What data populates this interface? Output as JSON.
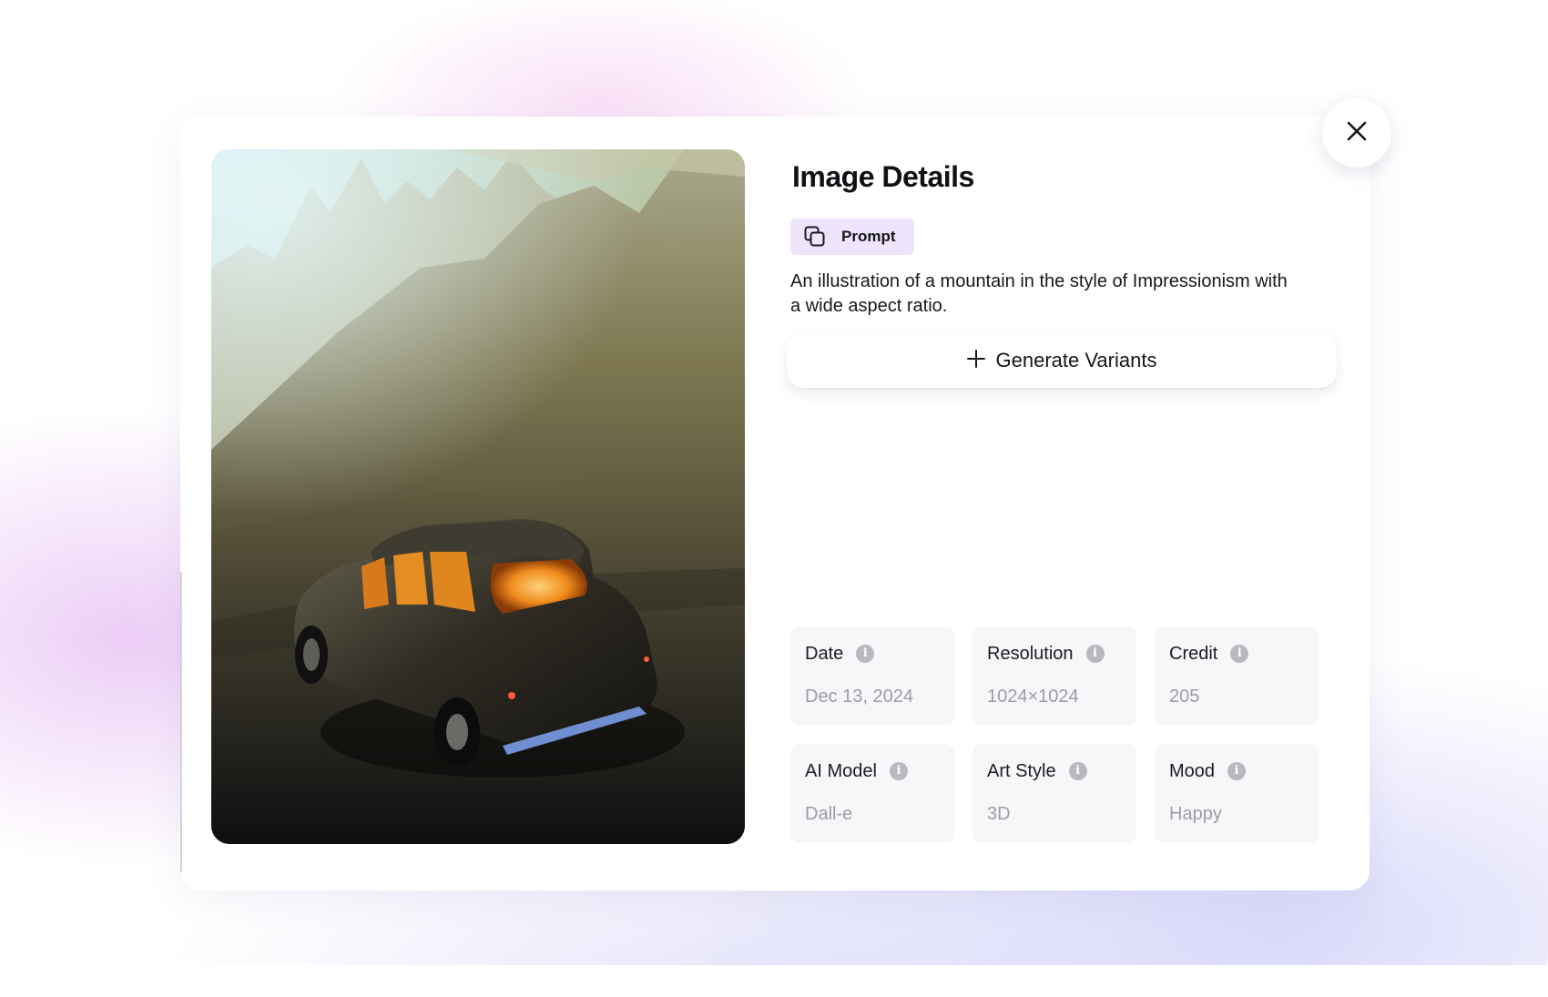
{
  "dialog": {
    "title": "Image Details",
    "close_icon": "close-icon",
    "prompt_chip": {
      "icon": "copy-icon",
      "label": "Prompt",
      "color": "#eee4fb"
    },
    "prompt_text": "An illustration of a mountain in the style of Impressionism with a wide aspect ratio.",
    "generate_button": {
      "icon": "plus-icon",
      "label": "Generate Variants"
    },
    "details": [
      {
        "label": "Date",
        "value": "Dec 13, 2024",
        "icon": "info-icon"
      },
      {
        "label": "Resolution",
        "value": "1024×1024",
        "icon": "info-icon"
      },
      {
        "label": "Credit",
        "value": "205",
        "icon": "info-icon"
      },
      {
        "label": "AI Model",
        "value": "Dall-e",
        "icon": "info-icon"
      },
      {
        "label": "Art Style",
        "value": "3D",
        "icon": "info-icon"
      },
      {
        "label": "Mood",
        "value": "Happy",
        "icon": "info-icon"
      }
    ]
  }
}
